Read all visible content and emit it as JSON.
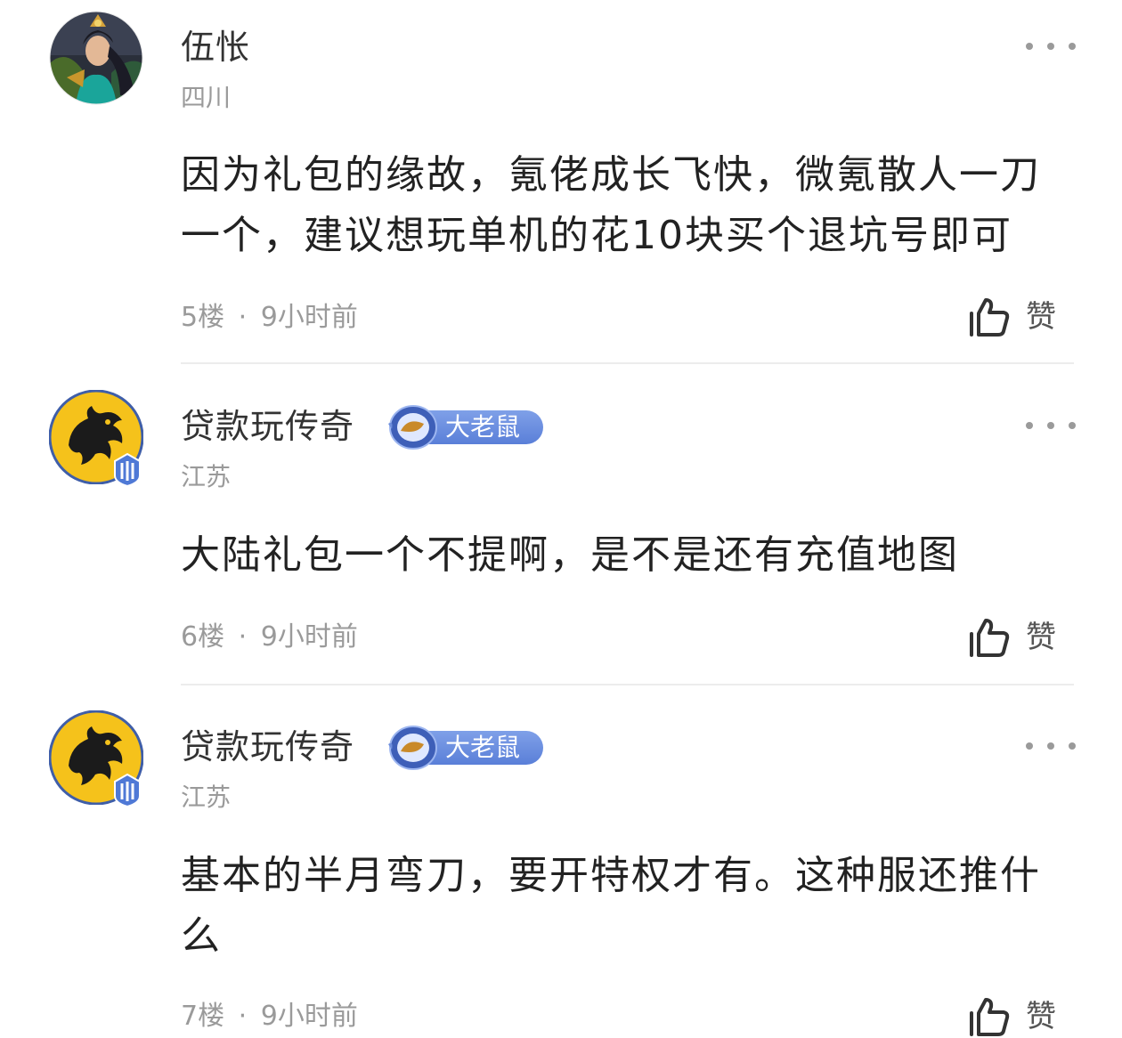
{
  "comments": [
    {
      "username": "伍怅",
      "badge": null,
      "location": "四川",
      "content": "因为礼包的缘故，氪佬成长飞快，微氪散人一刀一个，建议想玩单机的花10块买个退坑号即可",
      "floor": "5楼",
      "time": "9小时前",
      "like_label": "赞",
      "avatar_icon": "warrior-portrait-avatar"
    },
    {
      "username": "贷款玩传奇",
      "badge": "大老鼠",
      "location": "江苏",
      "content": "大陆礼包一个不提啊，是不是还有充值地图",
      "floor": "6楼",
      "time": "9小时前",
      "like_label": "赞",
      "avatar_icon": "dragon-avatar"
    },
    {
      "username": "贷款玩传奇",
      "badge": "大老鼠",
      "location": "江苏",
      "content": "基本的半月弯刀，要开特权才有。这种服还推什么",
      "floor": "7楼",
      "time": "9小时前",
      "like_label": "赞",
      "avatar_icon": "dragon-avatar"
    }
  ],
  "meta_separator": "·",
  "colors": {
    "badge_blue": "#5a7fd8",
    "avatar_gold": "#f5c21b",
    "text_secondary": "#9a9a9a",
    "divider": "#ececec"
  }
}
